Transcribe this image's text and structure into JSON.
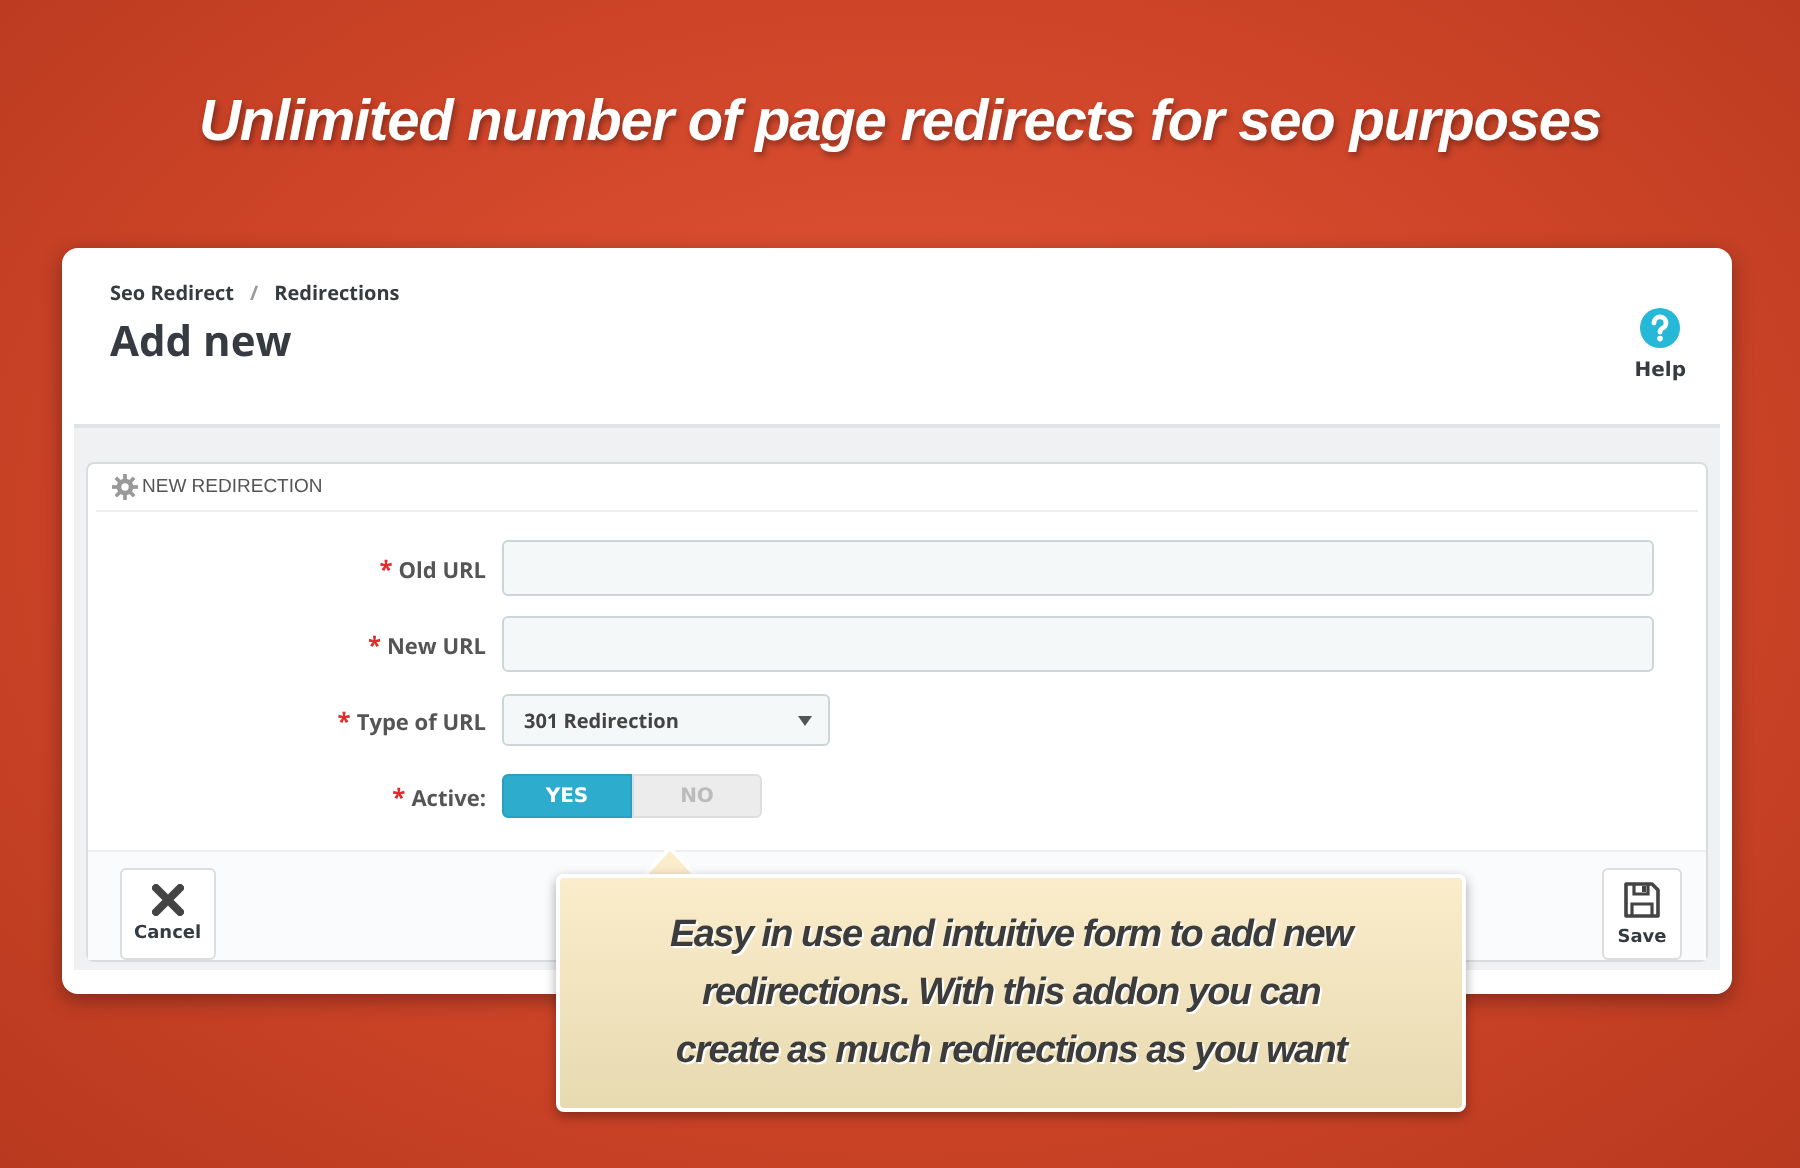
{
  "headline": "Unlimited number of page redirects for seo purposes",
  "breadcrumb": [
    "Seo Redirect",
    "/",
    "Redirections"
  ],
  "page_title": "Add new",
  "help": {
    "label": "Help"
  },
  "panel": {
    "title": "NEW REDIRECTION",
    "fields": [
      {
        "kind": "text",
        "label": "Old URL",
        "required_mark": "*"
      },
      {
        "kind": "text",
        "label": "New URL",
        "required_mark": "*"
      },
      {
        "kind": "select",
        "label": "Type of URL",
        "required_mark": "*",
        "value": "301 Redirection"
      },
      {
        "kind": "toggle",
        "label": "Active:",
        "required_mark": "*",
        "options": [
          {
            "label": "YES",
            "selected": true
          },
          {
            "label": "NO",
            "selected": false
          }
        ]
      }
    ],
    "buttons": [
      {
        "kind": "cancel",
        "label": "Cancel"
      },
      {
        "kind": "save",
        "label": "Save"
      }
    ]
  },
  "callout": "Easy in use and intuitive form to add new redirections. With this addon you can create as much redirections as you want"
}
